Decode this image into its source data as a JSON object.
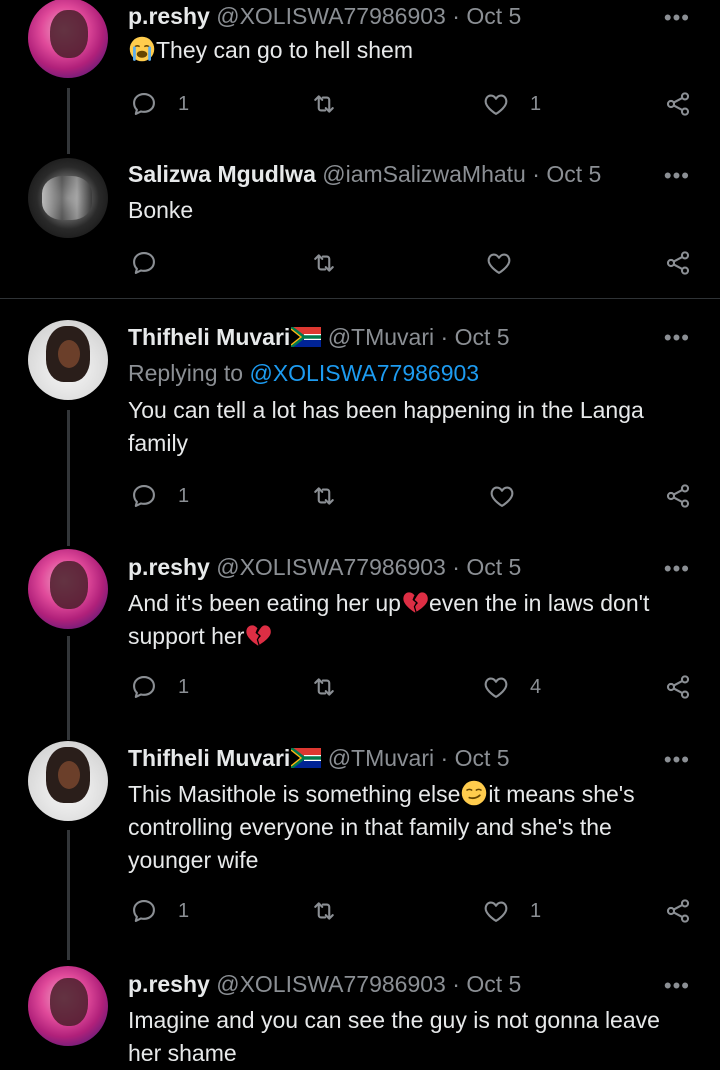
{
  "tweets": [
    {
      "name": "p.reshy",
      "handle": "@XOLISWA77986903",
      "date": "Oct 5",
      "avatar": "preshy-avatar",
      "flag": false,
      "replying_to": "",
      "lines": [
        "They can go to hell shem"
      ],
      "leading_emoji": "crying-face",
      "replies": "1",
      "retweets": "",
      "likes": "1"
    },
    {
      "name": "Salizwa Mgudlwa",
      "handle": "@iamSalizwaMhatu",
      "date": "Oct 5",
      "avatar": "salizwa-avatar",
      "flag": false,
      "replying_to": "",
      "lines": [
        "Bonke"
      ],
      "replies": "",
      "retweets": "",
      "likes": ""
    },
    {
      "name": "Thifheli Muvari",
      "handle": "@TMuvari",
      "date": "Oct 5",
      "avatar": "thifheli-avatar",
      "flag": true,
      "replying_to_prefix": "Replying to",
      "replying_to": "@XOLISWA77986903",
      "lines": [
        "You can tell a lot has been happening in the Langa",
        "family"
      ],
      "replies": "1",
      "retweets": "",
      "likes": ""
    },
    {
      "name": "p.reshy",
      "handle": "@XOLISWA77986903",
      "date": "Oct 5",
      "avatar": "preshy-avatar",
      "flag": false,
      "line1_a": "And it's been eating her up",
      "line1_b": "even the in laws don't",
      "line2": "support her",
      "replies": "1",
      "retweets": "",
      "likes": "4"
    },
    {
      "name": "Thifheli Muvari",
      "handle": "@TMuvari",
      "date": "Oct 5",
      "avatar": "thifheli-avatar",
      "flag": true,
      "line1_a": "This Masithole is something else",
      "line1_b": "it means she's",
      "lines_rest": [
        "controlling everyone in that family and she's the",
        "younger wife"
      ],
      "replies": "1",
      "retweets": "",
      "likes": "1"
    },
    {
      "name": "p.reshy",
      "handle": "@XOLISWA77986903",
      "date": "Oct 5",
      "avatar": "preshy-avatar",
      "flag": false,
      "lines": [
        "Imagine and you can see the guy is not gonna leave",
        "her shame"
      ]
    }
  ],
  "ui": {
    "dot": "·",
    "more": "•••"
  },
  "icons": [
    "reply-icon",
    "retweet-icon",
    "like-icon",
    "share-icon",
    "more-icon",
    "south-africa-flag-icon",
    "broken-heart-emoji",
    "smirk-emoji",
    "crying-face-emoji"
  ],
  "colors": {
    "background": "#000000",
    "text": "#e7e9ea",
    "secondary": "#8b8f94",
    "link": "#1d9bf0"
  }
}
